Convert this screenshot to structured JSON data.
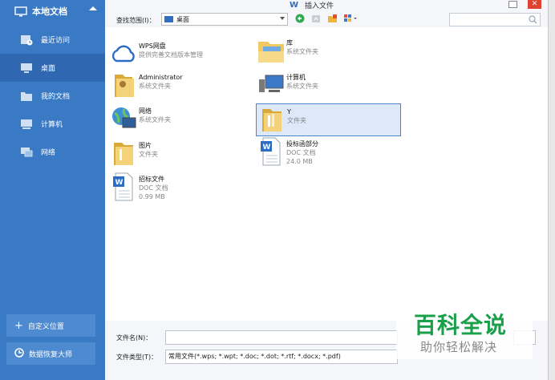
{
  "sidebar": {
    "title": "本地文档",
    "items": [
      {
        "label": "最近访问",
        "icon": "recent-icon",
        "active": false
      },
      {
        "label": "桌面",
        "icon": "desktop-icon",
        "active": true
      },
      {
        "label": "我的文档",
        "icon": "folder-icon",
        "active": false
      },
      {
        "label": "计算机",
        "icon": "computer-icon",
        "active": false
      },
      {
        "label": "网络",
        "icon": "network-icon",
        "active": false
      }
    ],
    "custom_location": "自定义位置",
    "data_recovery": "数据恢复大师"
  },
  "dialog": {
    "title": "插入文件",
    "look_in_label": "查找范围(I)：",
    "look_in_value": "桌面",
    "search_placeholder": ""
  },
  "files": [
    {
      "name": "WPS网盘",
      "sub": "提供完善文档版本管理",
      "size": "",
      "icon": "cloud-icon"
    },
    {
      "name": "库",
      "sub": "系统文件夹",
      "size": "",
      "icon": "library-icon"
    },
    {
      "name": "Administrator",
      "sub": "系统文件夹",
      "size": "",
      "icon": "user-folder-icon"
    },
    {
      "name": "计算机",
      "sub": "系统文件夹",
      "size": "",
      "icon": "computer-icon"
    },
    {
      "name": "网络",
      "sub": "系统文件夹",
      "size": "",
      "icon": "network-globe-icon"
    },
    {
      "name": "Y",
      "sub": "文件夹",
      "size": "",
      "icon": "folder-icon"
    },
    {
      "name": "图片",
      "sub": "文件夹",
      "size": "",
      "icon": "folder-icon"
    },
    {
      "name": "投标函部分",
      "sub": "DOC 文档",
      "size": "24.0 MB",
      "icon": "doc-icon"
    },
    {
      "name": "招标文件",
      "sub": "DOC 文档",
      "size": "0.99 MB",
      "icon": "doc-icon"
    }
  ],
  "bottom": {
    "filename_label": "文件名(N)：",
    "filename_value": "",
    "filetype_label": "文件类型(T)：",
    "filetype_value": "常用文件(*.wps; *.wpt; *.doc; *.dot; *.rtf; *.docx; *.pdf)"
  },
  "watermark": {
    "line1": "百科全说",
    "line2": "助你轻松解决"
  },
  "colors": {
    "sidebar": "#3a79c4",
    "sidebar_active": "#2f68b0",
    "selection": "#dde9f8",
    "close": "#e0422f",
    "watermark_green": "#1aa04a"
  }
}
